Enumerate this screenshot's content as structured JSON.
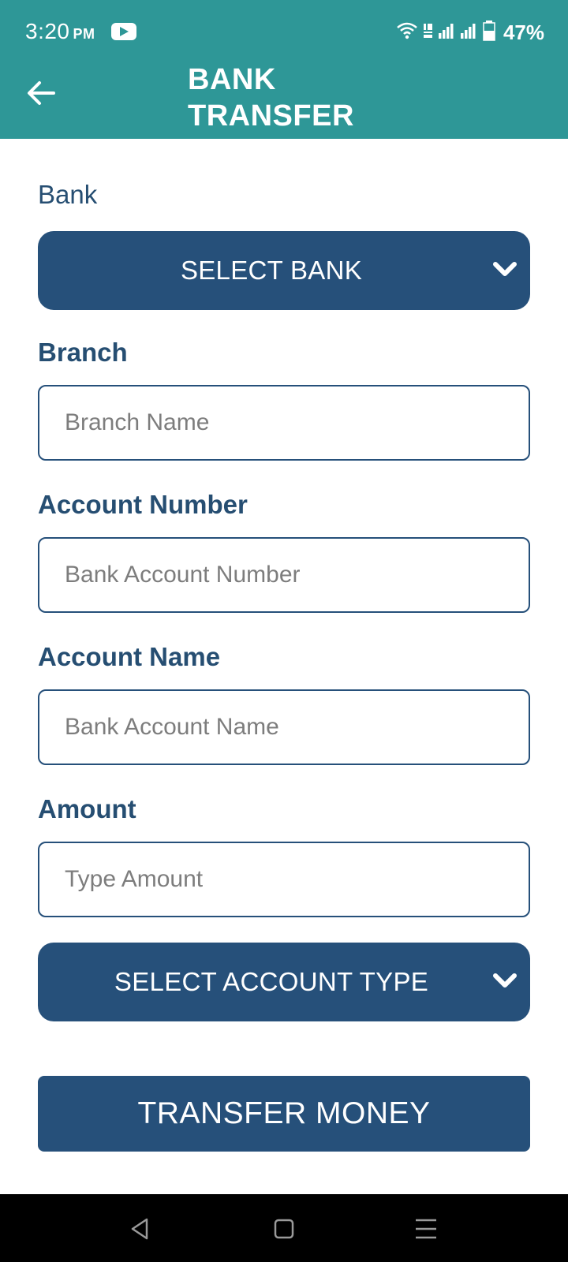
{
  "status_bar": {
    "time": "3:20",
    "ampm": "PM",
    "battery": "47%",
    "icons": [
      "youtube-icon",
      "wifi-icon",
      "volte-icon",
      "signal-icon",
      "signal-icon",
      "battery-icon"
    ]
  },
  "header": {
    "title": "BANK TRANSFER",
    "back_icon": "arrow-left-icon"
  },
  "form": {
    "bank_label": "Bank",
    "bank_select": "SELECT BANK",
    "branch_label": "Branch",
    "branch_placeholder": "Branch Name",
    "account_number_label": "Account Number",
    "account_number_placeholder": "Bank Account Number",
    "account_name_label": "Account Name",
    "account_name_placeholder": "Bank Account Name",
    "amount_label": "Amount",
    "amount_placeholder": "Type Amount",
    "account_type_select": "SELECT ACCOUNT TYPE",
    "submit_label": "TRANSFER MONEY"
  },
  "nav_bar": {
    "icons": [
      "back-triangle-icon",
      "home-square-icon",
      "menu-lines-icon"
    ]
  },
  "colors": {
    "header_bg": "#2e9797",
    "primary": "#26507a",
    "label": "#264e72",
    "placeholder": "#7d7d7d"
  }
}
